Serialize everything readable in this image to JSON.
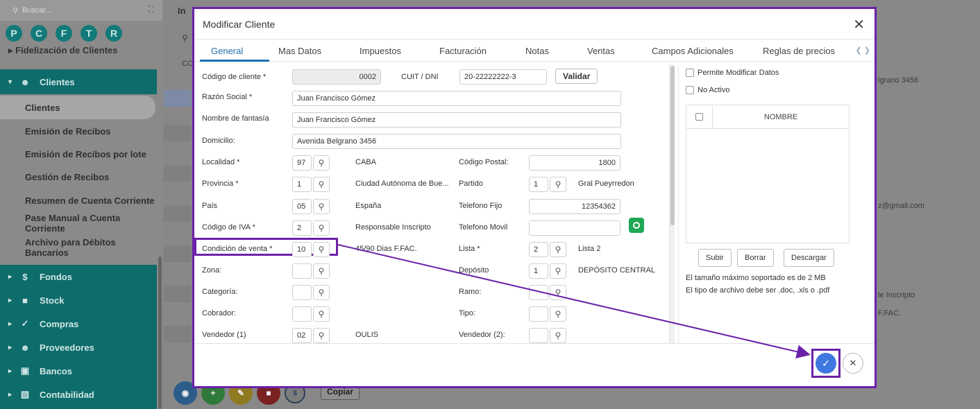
{
  "sidebar": {
    "search_placeholder": "Buscar...",
    "circles": [
      "P",
      "C",
      "F",
      "T",
      "R"
    ],
    "fidelizacion": "Fidelización de Clientes",
    "clientes_section": "Clientes",
    "items": [
      "Clientes",
      "Emisión de Recibos",
      "Emisión de Recibos por lote",
      "Gestión de Recibos",
      "Resumen de Cuenta Corriente",
      "Pase Manual a Cuenta Corriente",
      "Archivo para Débitos Bancarios"
    ],
    "sections": [
      "Fondos",
      "Stock",
      "Compras",
      "Proveedores",
      "Bancos",
      "Contabilidad"
    ]
  },
  "background": {
    "tab_fragment": "In",
    "col_fragment": "CC",
    "addr": "lgrano 3456",
    "email": "z@gmail.com",
    "iva": "le Inscripto",
    "cond": "F.FAC.",
    "copiar": "Copiar"
  },
  "modal": {
    "title": "Modificar Cliente",
    "tabs": [
      "General",
      "Mas Datos",
      "Impuestos",
      "Facturación",
      "Notas",
      "Ventas",
      "Campos Adicionales",
      "Reglas de precios"
    ],
    "fields": {
      "codigo_label": "Código de cliente *",
      "codigo_value": "0002",
      "cuit_label": "CUIT / DNI",
      "cuit_value": "20-22222222-3",
      "validar": "Validar",
      "razon_label": "Razón Social *",
      "razon_value": "Juan Francisco Gómez",
      "fantasia_label": "Nombre de fantasía",
      "fantasia_value": "Juan Francisco Gómez",
      "domicilio_label": "Domicilio:",
      "domicilio_value": "Avenida Belgrano 3456",
      "localidad_label": "Localidad *",
      "localidad_code": "97",
      "localidad_name": "CABA",
      "cp_label": "Código Postal:",
      "cp_value": "1800",
      "provincia_label": "Provincia *",
      "provincia_code": "1",
      "provincia_name": "Ciudad Autónoma de Bue...",
      "partido_label": "Partido",
      "partido_code": "1",
      "partido_name": "Gral Pueyrredon",
      "pais_label": "País",
      "pais_code": "05",
      "pais_name": "España",
      "tel_fijo_label": "Telefono Fijo",
      "tel_fijo_value": "12354362",
      "iva_label": "Código de IVA *",
      "iva_code": "2",
      "iva_name": "Responsable Inscripto",
      "tel_movil_label": "Telefono Movil",
      "tel_movil_value": "",
      "cond_label": "Condición de venta *",
      "cond_code": "10",
      "cond_name": "45/90 Dias F.FAC.",
      "lista_label": "Lista *",
      "lista_code": "2",
      "lista_name": "Lista 2",
      "zona_label": "Zona:",
      "deposito_label": "Depósito",
      "deposito_code": "1",
      "deposito_name": "DEPÓSITO CENTRAL",
      "categoria_label": "Categoría:",
      "ramo_label": "Ramo:",
      "cobrador_label": "Cobrador:",
      "tipo_label": "Tipo:",
      "vendedor1_label": "Vendedor (1)",
      "vendedor1_code": "02",
      "vendedor1_name": "OULIS",
      "vendedor2_label": "Vendedor (2):"
    },
    "right": {
      "permite": "Permite Modificar Datos",
      "no_activo": "No Activo",
      "col_nombre": "NOMBRE",
      "subir": "Subir",
      "borrar": "Borrar",
      "descargar": "Descargar",
      "note1": "El tamaño máximo soportado es de 2 MB",
      "note2": "El tipo de archivo debe ser .doc, .xls o .pdf"
    }
  },
  "colors": {
    "accent": "#6b22a8",
    "primary_blue": "#3f77e0",
    "tab_active": "#1c6fb0",
    "sidebar_teal": "#0e6c6b"
  }
}
